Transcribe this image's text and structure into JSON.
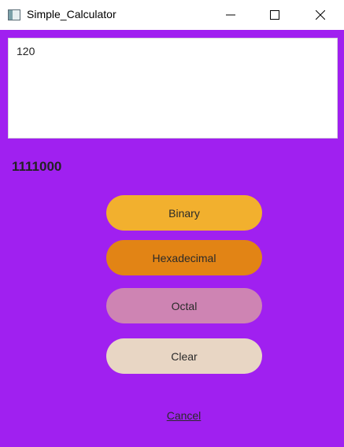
{
  "window": {
    "title": "Simple_Calculator",
    "background": "#A020F0"
  },
  "input": {
    "value": "120"
  },
  "result": {
    "value": "1111000"
  },
  "buttons": {
    "binary": {
      "label": "Binary",
      "color": "#F2B02E"
    },
    "hexadecimal": {
      "label": "Hexadecimal",
      "color": "#E28415"
    },
    "octal": {
      "label": "Octal",
      "color": "#CE84B3"
    },
    "clear": {
      "label": "Clear",
      "color": "#E8D6C4"
    }
  },
  "cancel": {
    "label": "Cancel"
  },
  "icons": {
    "app": "app-window-icon",
    "minimize": "minimize-icon",
    "maximize": "maximize-icon",
    "close": "close-icon"
  }
}
